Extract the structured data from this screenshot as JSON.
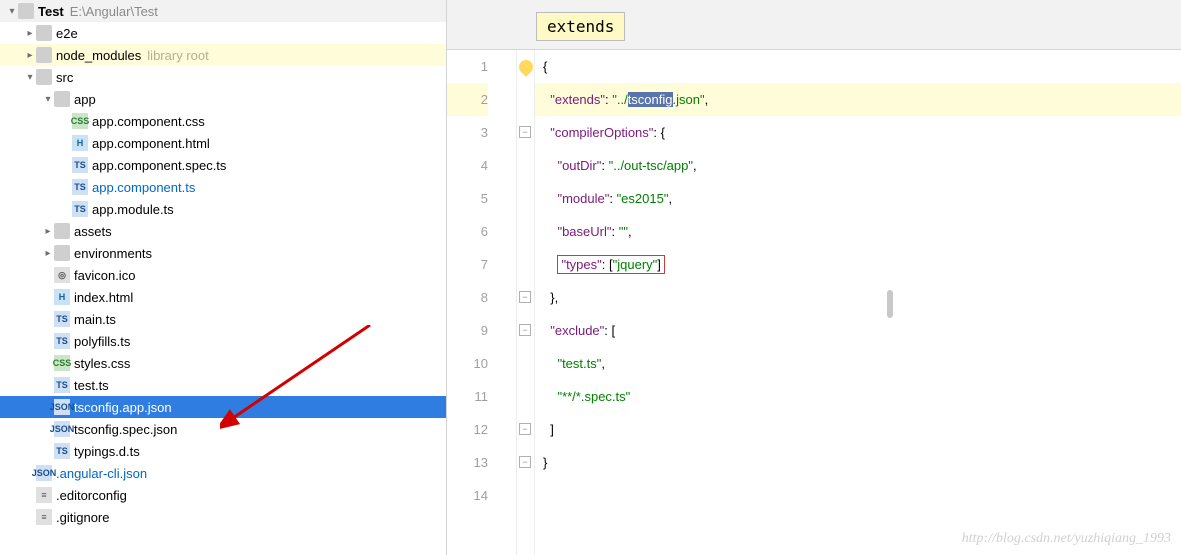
{
  "project": {
    "name": "Test",
    "path": "E:\\Angular\\Test"
  },
  "tree": [
    {
      "depth": 0,
      "arrow": "down",
      "icon": "folder",
      "label": "Test",
      "bold": true,
      "suffix": "E:\\Angular\\Test"
    },
    {
      "depth": 1,
      "arrow": "right",
      "icon": "folder",
      "label": "e2e"
    },
    {
      "depth": 1,
      "arrow": "right",
      "icon": "folder",
      "label": "node_modules",
      "suffix": "library root",
      "hl": true
    },
    {
      "depth": 1,
      "arrow": "down",
      "icon": "folder",
      "label": "src"
    },
    {
      "depth": 2,
      "arrow": "down",
      "icon": "folder",
      "label": "app"
    },
    {
      "depth": 3,
      "arrow": "",
      "icon": "css",
      "label": "app.component.css"
    },
    {
      "depth": 3,
      "arrow": "",
      "icon": "html",
      "label": "app.component.html"
    },
    {
      "depth": 3,
      "arrow": "",
      "icon": "ts",
      "label": "app.component.spec.ts"
    },
    {
      "depth": 3,
      "arrow": "",
      "icon": "ts",
      "label": "app.component.ts",
      "blue": true
    },
    {
      "depth": 3,
      "arrow": "",
      "icon": "ts",
      "label": "app.module.ts"
    },
    {
      "depth": 2,
      "arrow": "right",
      "icon": "folder",
      "label": "assets"
    },
    {
      "depth": 2,
      "arrow": "right",
      "icon": "folder",
      "label": "environments"
    },
    {
      "depth": 2,
      "arrow": "",
      "icon": "ico",
      "label": "favicon.ico"
    },
    {
      "depth": 2,
      "arrow": "",
      "icon": "html",
      "label": "index.html"
    },
    {
      "depth": 2,
      "arrow": "",
      "icon": "ts",
      "label": "main.ts"
    },
    {
      "depth": 2,
      "arrow": "",
      "icon": "ts",
      "label": "polyfills.ts"
    },
    {
      "depth": 2,
      "arrow": "",
      "icon": "css",
      "label": "styles.css"
    },
    {
      "depth": 2,
      "arrow": "",
      "icon": "ts",
      "label": "test.ts"
    },
    {
      "depth": 2,
      "arrow": "",
      "icon": "json",
      "label": "tsconfig.app.json",
      "selected": true
    },
    {
      "depth": 2,
      "arrow": "",
      "icon": "json",
      "label": "tsconfig.spec.json"
    },
    {
      "depth": 2,
      "arrow": "",
      "icon": "ts",
      "label": "typings.d.ts"
    },
    {
      "depth": 1,
      "arrow": "",
      "icon": "json",
      "label": ".angular-cli.json",
      "blue": true
    },
    {
      "depth": 1,
      "arrow": "",
      "icon": "generic",
      "label": ".editorconfig"
    },
    {
      "depth": 1,
      "arrow": "",
      "icon": "generic",
      "label": ".gitignore"
    }
  ],
  "tooltip": "extends",
  "editor": {
    "line_numbers": [
      "1",
      "2",
      "3",
      "4",
      "5",
      "6",
      "7",
      "8",
      "9",
      "10",
      "11",
      "12",
      "13",
      "14"
    ],
    "current_line": 2,
    "tokens": {
      "l1_open": "{",
      "l2_key": "\"extends\"",
      "l2_colon": ": ",
      "l2_sa": "\"../",
      "l2_sel": "tsconfig",
      "l2_sb": ".json\"",
      "l2_end": ",",
      "l3_key": "\"compilerOptions\"",
      "l3_rest": ": {",
      "l4_key": "\"outDir\"",
      "l4_colon": ": ",
      "l4_val": "\"../out-tsc/app\"",
      "l4_end": ",",
      "l5_key": "\"module\"",
      "l5_colon": ": ",
      "l5_val": "\"es2015\"",
      "l5_end": ",",
      "l6_key": "\"baseUrl\"",
      "l6_colon": ": ",
      "l6_val": "\"\"",
      "l6_end": ",",
      "l7_key": "\"types\"",
      "l7_colon": ": ",
      "l7_open": "[",
      "l7_val": "\"jquery\"",
      "l7_close": "]",
      "l8": "},",
      "l9_key": "\"exclude\"",
      "l9_rest": ": [",
      "l10_val": "\"test.ts\"",
      "l10_end": ",",
      "l11_val": "\"**/*.spec.ts\"",
      "l12": "]",
      "l13": "}"
    }
  },
  "watermark": "http://blog.csdn.net/yuzhiqiang_1993"
}
